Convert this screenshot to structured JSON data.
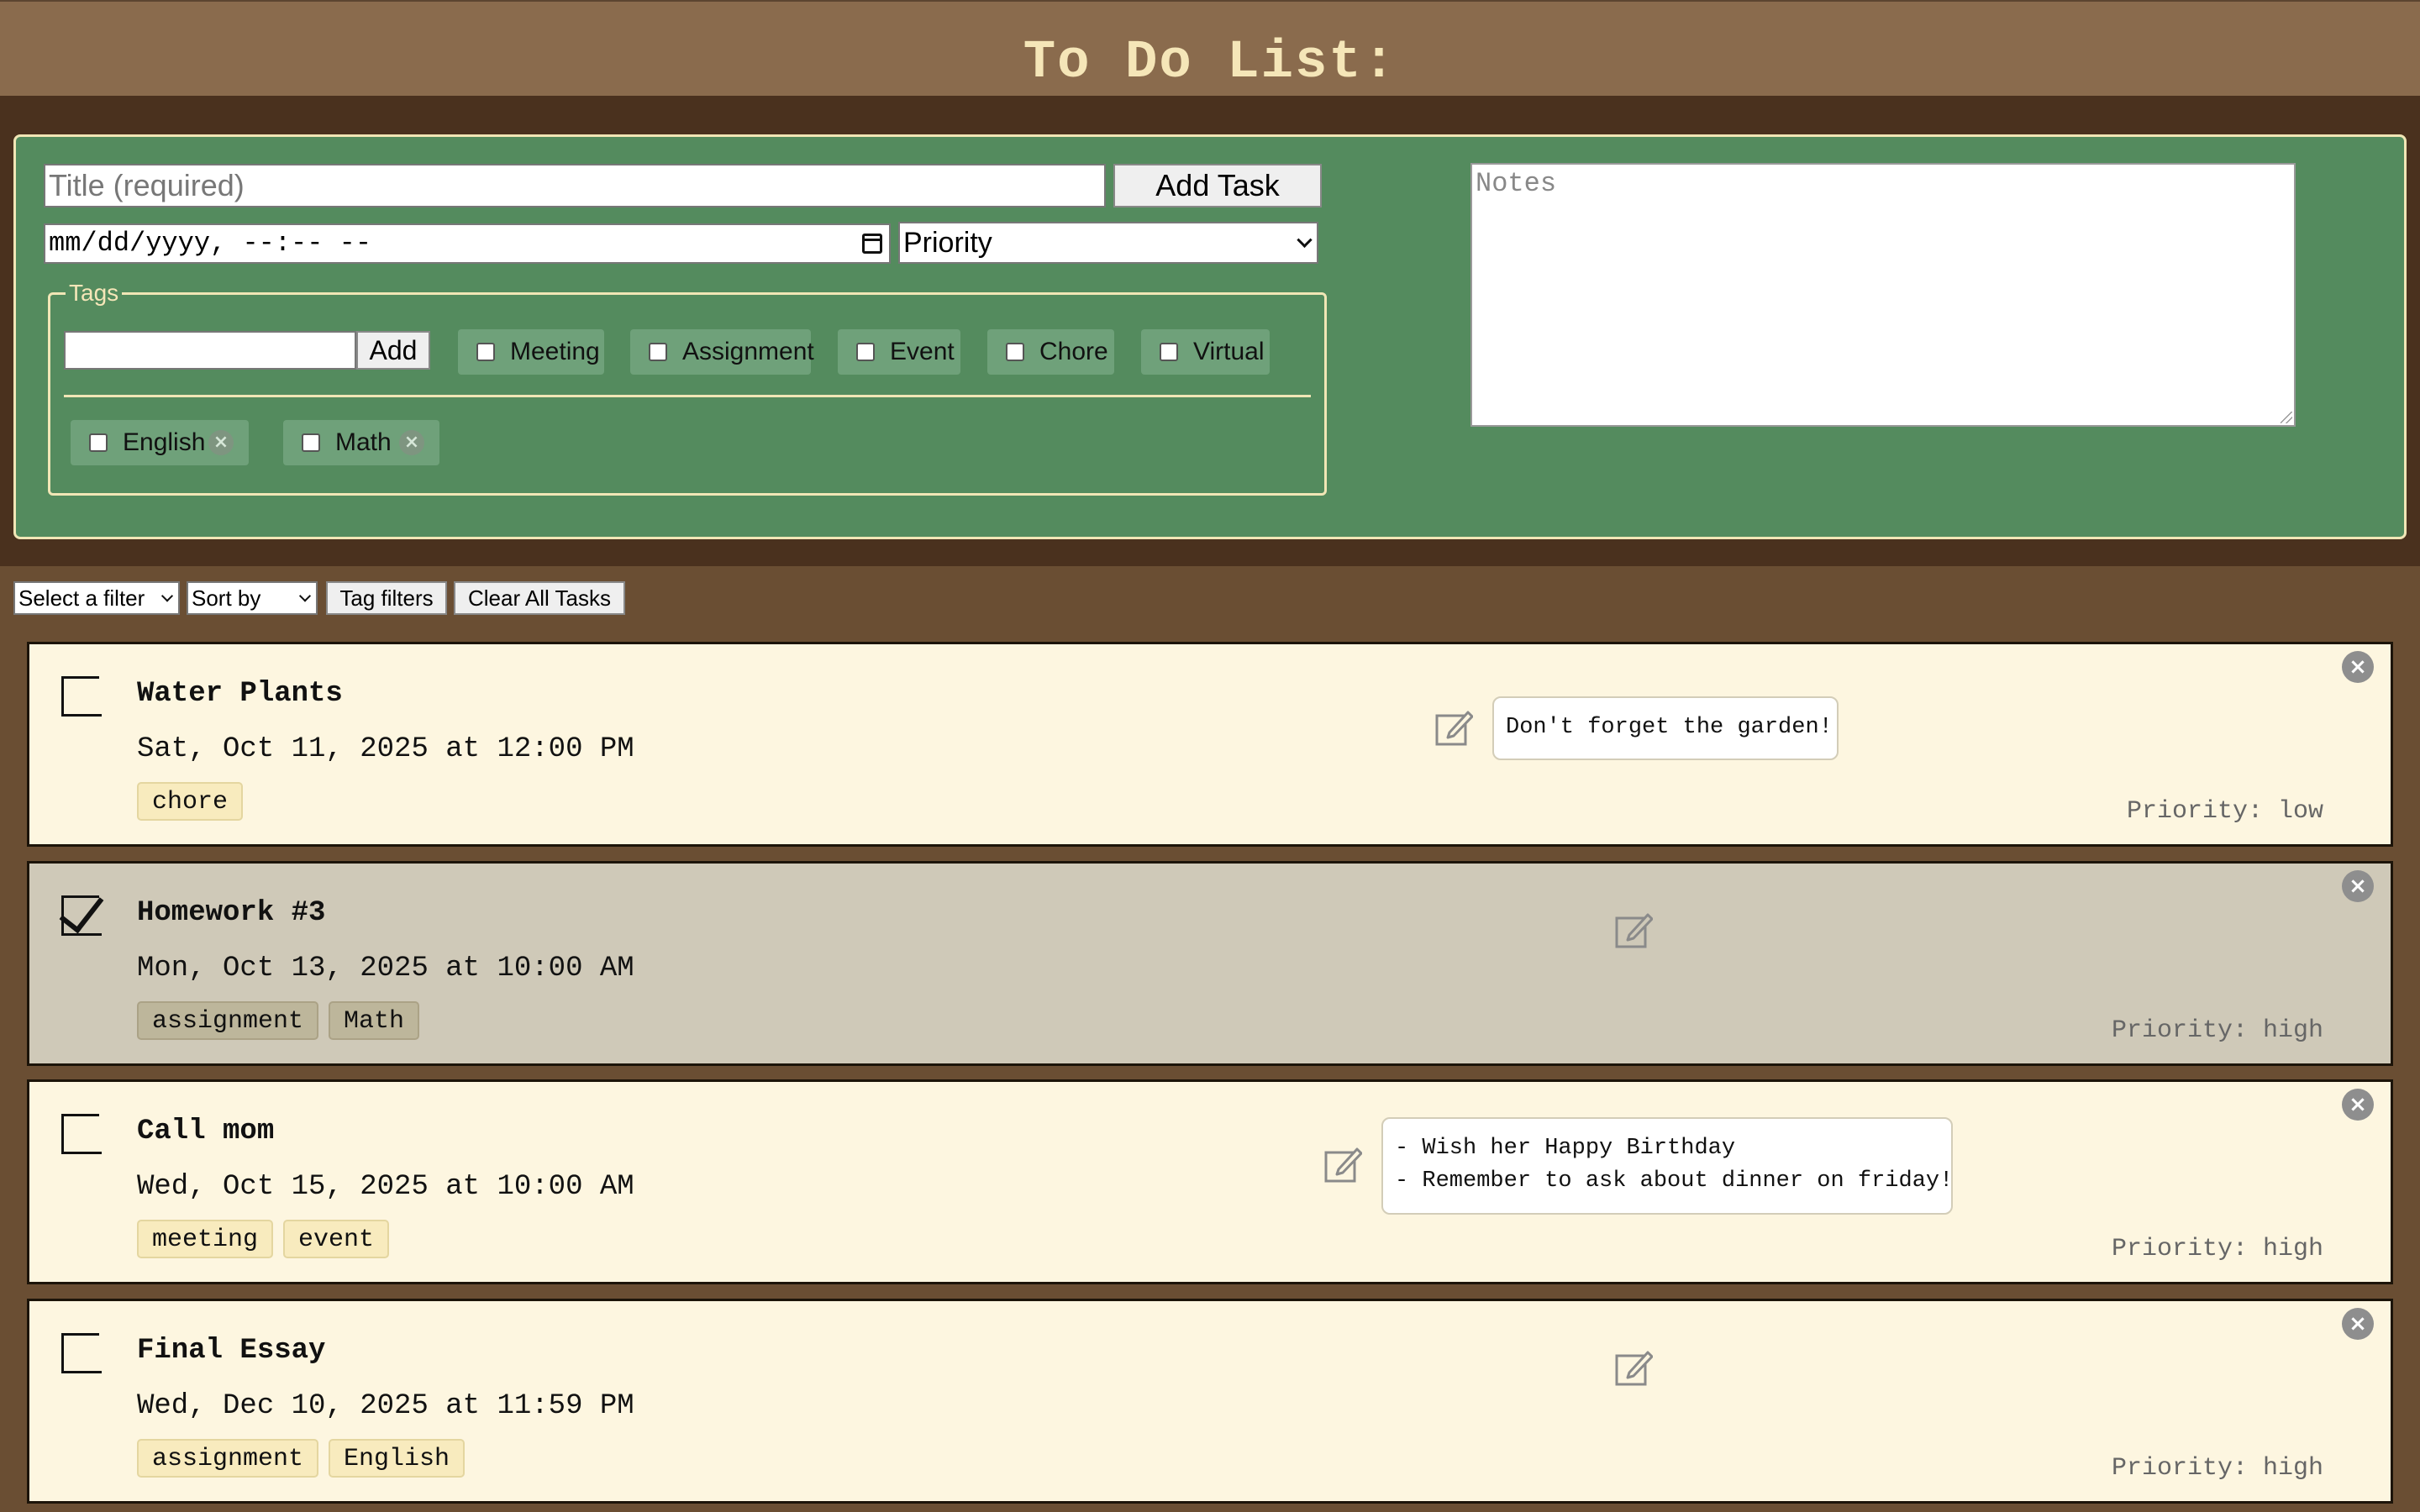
{
  "app": {
    "title": "To Do List:"
  },
  "form": {
    "title_placeholder": "Title (required)",
    "add_task_label": "Add Task",
    "date_placeholder": "mm/dd/yyyy, --:-- --",
    "priority_selected": "Priority",
    "notes_placeholder": "Notes",
    "tags_legend": "Tags",
    "tag_add_label": "Add",
    "preset_tags": [
      "Meeting",
      "Assignment",
      "Event",
      "Chore",
      "Virtual"
    ],
    "custom_tags": [
      "English",
      "Math"
    ],
    "remove_icon": "close-icon"
  },
  "controls": {
    "filter_selected": "Select a filter",
    "sort_selected": "Sort by",
    "tag_filters_label": "Tag filters",
    "clear_all_label": "Clear All Tasks"
  },
  "tasks": [
    {
      "title": "Water Plants",
      "date": "Sat, Oct 11, 2025 at 12:00 PM",
      "tags": [
        "chore"
      ],
      "priority": "Priority: low",
      "completed": false,
      "note": "Don't forget the garden!"
    },
    {
      "title": "Homework #3",
      "date": "Mon, Oct 13, 2025 at 10:00 AM",
      "tags": [
        "assignment",
        "Math"
      ],
      "priority": "Priority: high",
      "completed": true,
      "note": ""
    },
    {
      "title": "Call mom",
      "date": "Wed, Oct 15, 2025 at 10:00 AM",
      "tags": [
        "meeting",
        "event"
      ],
      "priority": "Priority: high",
      "completed": false,
      "note": "- Wish her Happy Birthday\n- Remember to ask about dinner on friday!"
    },
    {
      "title": "Final Essay",
      "date": "Wed, Dec 10, 2025 at 11:59 PM",
      "tags": [
        "assignment",
        "English"
      ],
      "priority": "Priority: high",
      "completed": false,
      "note": ""
    }
  ],
  "icons": {
    "edit": "edit-icon",
    "delete": "close-icon",
    "calendar": "calendar-icon"
  },
  "colors": {
    "header": "#8a6b4d",
    "panel": "#548b5e",
    "card": "#fdf6e0",
    "card_done": "#cfc9b8",
    "title_text": "#f5e6b8"
  }
}
